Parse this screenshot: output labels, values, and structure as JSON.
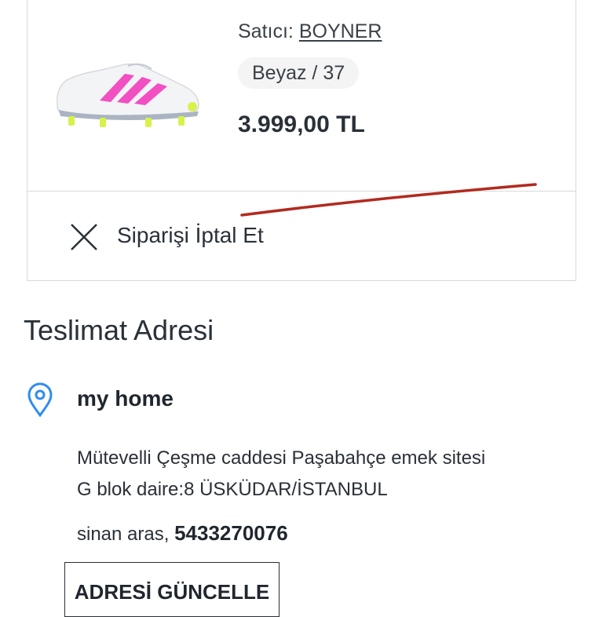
{
  "product": {
    "seller_label": "Satıcı:",
    "seller_name": "BOYNER",
    "variant": "Beyaz / 37",
    "price": "3.999,00 TL"
  },
  "cancel": {
    "label": "Siparişi İptal Et",
    "icon": "close-icon"
  },
  "delivery": {
    "title": "Teslimat Adresi",
    "icon": "location-pin-icon",
    "name": "my home",
    "address_line1": "Mütevelli Çeşme caddesi Paşabahçe emek sitesi",
    "address_line2": "G blok daire:8 ÜSKÜDAR/İSTANBUL",
    "recipient": "sinan aras,",
    "phone": "5433270076",
    "update_label": "ADRESİ GÜNCELLE"
  },
  "colors": {
    "pin": "#2f8cf0",
    "annotation": "#b22a1e",
    "shoe_pink": "#f24fc2",
    "shoe_lime": "#d8f24a"
  }
}
